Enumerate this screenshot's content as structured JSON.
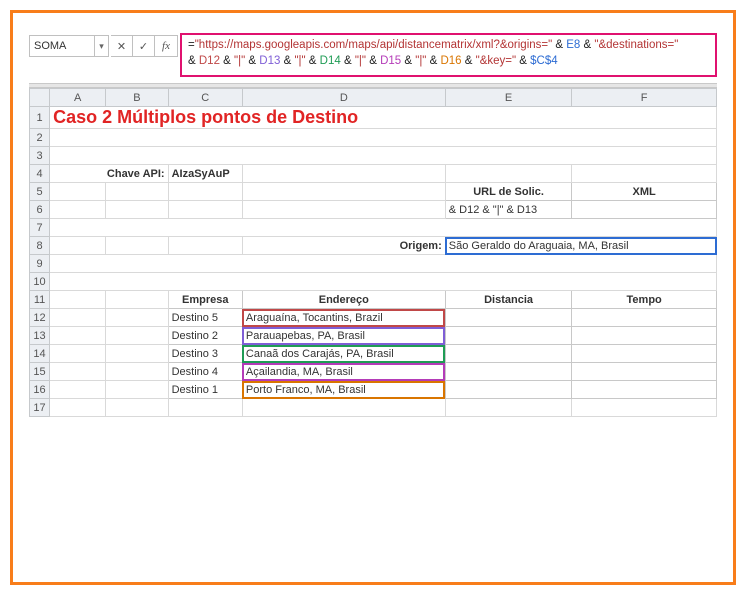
{
  "namebox": {
    "value": "SOMA"
  },
  "fx": {
    "cancel": "✕",
    "accept": "✓",
    "label": "fx"
  },
  "formula": {
    "prefix": "=",
    "s1": "\"https://maps.googleapis.com/maps/api/distancematrix/xml?&origins=\"",
    "amp": " & ",
    "e8": "E8",
    "s2": "\"&destinations=\"",
    "brk": "&",
    "d12": "D12",
    "pipe": "\"|\"",
    "d13": "D13",
    "d14": "D14",
    "d15": "D15",
    "d16": "D16",
    "s3": "\"&key=\"",
    "abs": "$C$4"
  },
  "cols": {
    "A": "A",
    "B": "B",
    "C": "C",
    "D": "D",
    "E": "E",
    "F": "F"
  },
  "rows": [
    "1",
    "2",
    "3",
    "4",
    "5",
    "6",
    "7",
    "8",
    "9",
    "10",
    "11",
    "12",
    "13",
    "14",
    "15",
    "16",
    "17"
  ],
  "content": {
    "title": "Caso 2 Múltiplos pontos de Destino",
    "api_label": "Chave API:",
    "api_key": "AIzaSyAuP",
    "url_header": "URL de Solic.",
    "xml_header": "XML",
    "editing": "& D12 & \"|\"  & D13",
    "origem_label": "Origem:",
    "origem_value": "São Geraldo do Araguaia, MA, Brasil",
    "col_empresa": "Empresa",
    "col_endereco": "Endereço",
    "col_distancia": "Distancia",
    "col_tempo": "Tempo",
    "dest": [
      {
        "name": "Destino 5",
        "addr": "Araguaína, Tocantins, Brazil"
      },
      {
        "name": "Destino 2",
        "addr": "Parauapebas, PA, Brasil"
      },
      {
        "name": "Destino 3",
        "addr": "Canaã dos Carajás, PA, Brasil"
      },
      {
        "name": "Destino 4",
        "addr": "Açailandia, MA, Brasil"
      },
      {
        "name": "Destino 1",
        "addr": "Porto Franco, MA, Brasil"
      }
    ]
  }
}
